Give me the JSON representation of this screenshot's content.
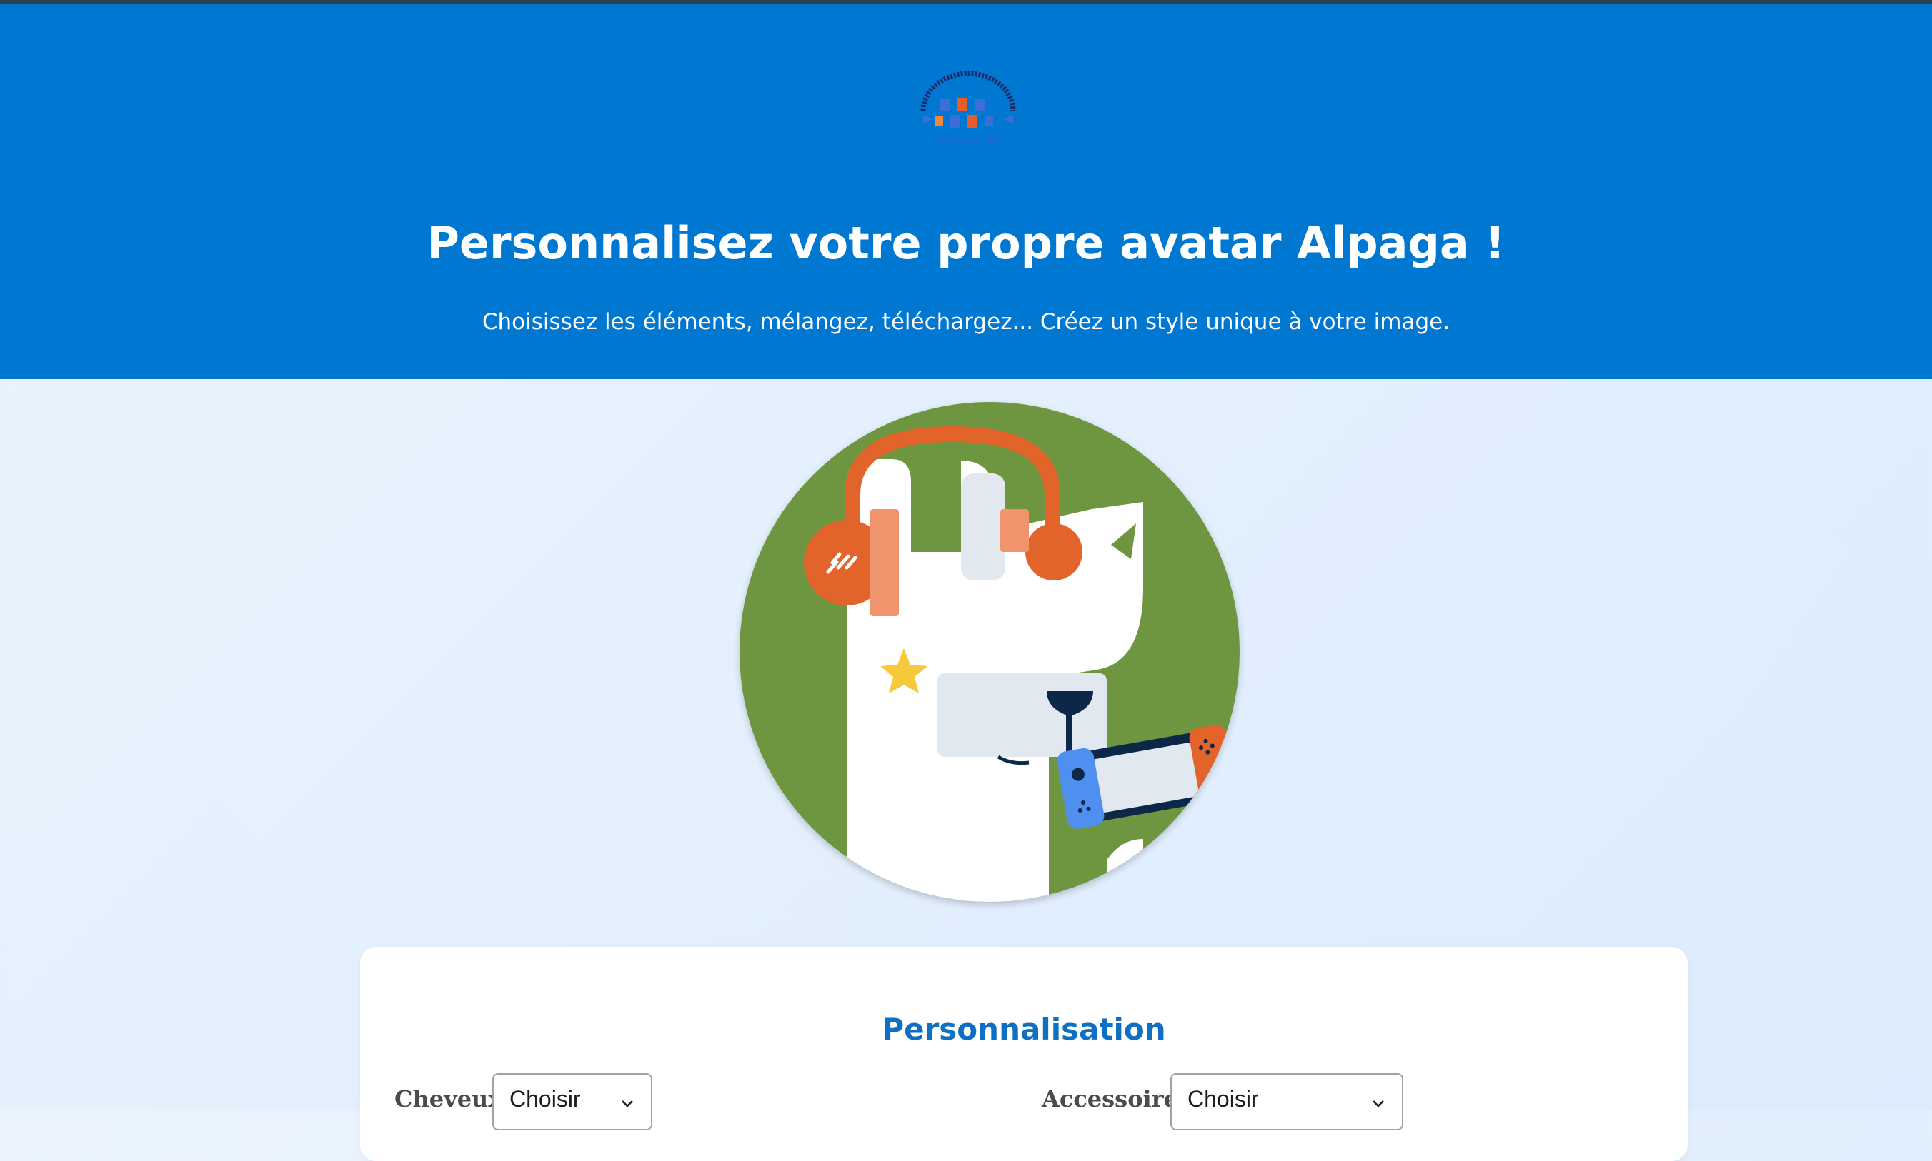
{
  "header": {
    "logo_icon": "ribbon-logo-icon",
    "title": "Personnalisez votre propre avatar Alpaga !",
    "subtitle": "Choisissez les éléments, mélangez, téléchargez... Créez un style unique à votre image.",
    "background_color": "#0077d0"
  },
  "avatar": {
    "background_color": "#6e9640",
    "accessories": [
      "headphones-icon",
      "star-icon",
      "game-console-icon"
    ]
  },
  "panel": {
    "title": "Personnalisation",
    "fields": [
      {
        "label": "Cheveux",
        "value": "Choisir",
        "icon": "chevron-down-icon"
      },
      {
        "label": "Accessoires",
        "value": "Choisir",
        "icon": "chevron-down-icon"
      }
    ]
  }
}
